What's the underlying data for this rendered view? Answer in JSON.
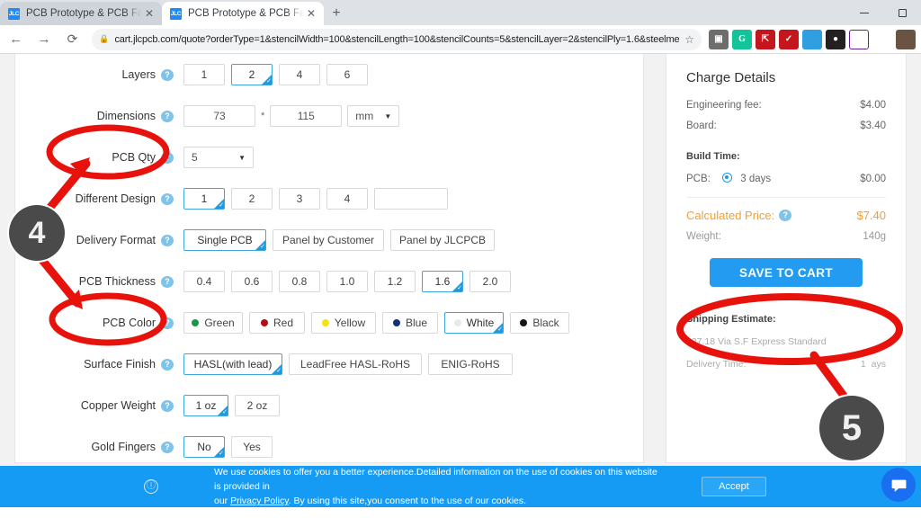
{
  "browser": {
    "tabs": [
      {
        "title": "PCB Prototype & PCB Fabrication",
        "favicon": "JLC",
        "active": false,
        "close": "✕"
      },
      {
        "title": "PCB Prototype & PCB Fabrication",
        "favicon": "JLC",
        "active": true,
        "close": "✕"
      }
    ],
    "new_tab_label": "+",
    "window_controls": {
      "minimize": "minimize-icon",
      "maximize": "maximize-icon"
    },
    "nav": {
      "back": "←",
      "forward": "→",
      "reload": "⟳"
    },
    "omnibox": {
      "lock": "🔒",
      "url": "cart.jlcpcb.com/quote?orderType=1&stencilWidth=100&stencilLength=100&stencilCounts=5&stencilLayer=2&stencilPly=1.6&steelmes...",
      "star": "☆"
    },
    "extensions": [
      {
        "name": "clipboard-extension-icon",
        "glyph": "▣"
      },
      {
        "name": "grammarly-extension-icon",
        "glyph": "G"
      },
      {
        "name": "pdf-extension-icon",
        "glyph": "A"
      },
      {
        "name": "acrobat-extension-icon",
        "glyph": "✓"
      },
      {
        "name": "globe-extension-icon",
        "glyph": ""
      },
      {
        "name": "adblock-extension-icon",
        "glyph": ""
      },
      {
        "name": "notes-extension-icon",
        "glyph": "▥"
      },
      {
        "name": "puzzle-extensions-icon",
        "glyph": "🧩"
      },
      {
        "name": "profile-avatar-icon",
        "glyph": ""
      }
    ]
  },
  "form": {
    "rows": [
      {
        "label": "Layers",
        "type": "options",
        "options": [
          {
            "text": "1",
            "selected": false
          },
          {
            "text": "2",
            "selected": true
          },
          {
            "text": "4",
            "selected": false
          },
          {
            "text": "6",
            "selected": false
          }
        ]
      },
      {
        "label": "Dimensions",
        "type": "dimensions",
        "width": "73",
        "separator": "*",
        "height": "115",
        "unit": "mm"
      },
      {
        "label": "PCB Qty",
        "type": "select",
        "value": "5"
      },
      {
        "label": "Different Design",
        "type": "options_with_input",
        "options": [
          {
            "text": "1",
            "selected": true
          },
          {
            "text": "2",
            "selected": false
          },
          {
            "text": "3",
            "selected": false
          },
          {
            "text": "4",
            "selected": false
          }
        ],
        "input_value": ""
      },
      {
        "label": "Delivery Format",
        "type": "options",
        "options": [
          {
            "text": "Single PCB",
            "selected": true
          },
          {
            "text": "Panel by Customer",
            "selected": false
          },
          {
            "text": "Panel by JLCPCB",
            "selected": false
          }
        ]
      },
      {
        "label": "PCB Thickness",
        "type": "options",
        "options": [
          {
            "text": "0.4",
            "selected": false
          },
          {
            "text": "0.6",
            "selected": false
          },
          {
            "text": "0.8",
            "selected": false
          },
          {
            "text": "1.0",
            "selected": false
          },
          {
            "text": "1.2",
            "selected": false
          },
          {
            "text": "1.6",
            "selected": true
          },
          {
            "text": "2.0",
            "selected": false
          }
        ]
      },
      {
        "label": "PCB Color",
        "type": "color_options",
        "options": [
          {
            "text": "Green",
            "selected": false,
            "swatch": "#1a9648"
          },
          {
            "text": "Red",
            "selected": false,
            "swatch": "#b00d14"
          },
          {
            "text": "Yellow",
            "selected": false,
            "swatch": "#f5e112"
          },
          {
            "text": "Blue",
            "selected": false,
            "swatch": "#15307a"
          },
          {
            "text": "White",
            "selected": true,
            "swatch": "#e9e9e9"
          },
          {
            "text": "Black",
            "selected": false,
            "swatch": "#141414"
          }
        ]
      },
      {
        "label": "Surface Finish",
        "type": "options",
        "options": [
          {
            "text": "HASL(with lead)",
            "selected": true
          },
          {
            "text": "LeadFree HASL-RoHS",
            "selected": false
          },
          {
            "text": "ENIG-RoHS",
            "selected": false
          }
        ]
      },
      {
        "label": "Copper Weight",
        "type": "options",
        "options": [
          {
            "text": "1 oz",
            "selected": true
          },
          {
            "text": "2 oz",
            "selected": false
          }
        ]
      },
      {
        "label": "Gold Fingers",
        "type": "options",
        "options": [
          {
            "text": "No",
            "selected": true
          },
          {
            "text": "Yes",
            "selected": false
          }
        ]
      }
    ]
  },
  "charge": {
    "title": "Charge Details",
    "lines": [
      {
        "label": "Engineering fee:",
        "value": "$4.00"
      },
      {
        "label": "Board:",
        "value": "$3.40"
      }
    ],
    "build_time_label": "Build Time:",
    "build_time": {
      "label": "PCB:",
      "option": "3 days",
      "value": "$0.00"
    },
    "calculated_price_label": "Calculated Price:",
    "calculated_price": "$7.40",
    "weight_label": "Weight:",
    "weight_value": "140g",
    "save_to_cart": "SAVE TO CART",
    "shipping_title": "Shipping Estimate:",
    "shipping_cost": "$27.18  Via  S.F Express Standard",
    "delivery_label": "Delivery Time:",
    "delivery_value": "1",
    "delivery_unit": "ays"
  },
  "annotations": {
    "badge_4": "4",
    "badge_5": "5",
    "accent_red": "#e8120c",
    "badge_bg": "#4a4a4a"
  },
  "cookie": {
    "icon": "cookie-info-icon",
    "text_line1": "We use cookies to offer you a better experience.Detailed information on the use of cookies on this website is provided in",
    "text_line2_pre": "our ",
    "privacy_link": "Privacy Policy",
    "text_line2_post": ". By using this site,you consent to the use of our cookies.",
    "accept_label": "Accept"
  },
  "chat": {
    "name": "chat-widget-icon"
  }
}
